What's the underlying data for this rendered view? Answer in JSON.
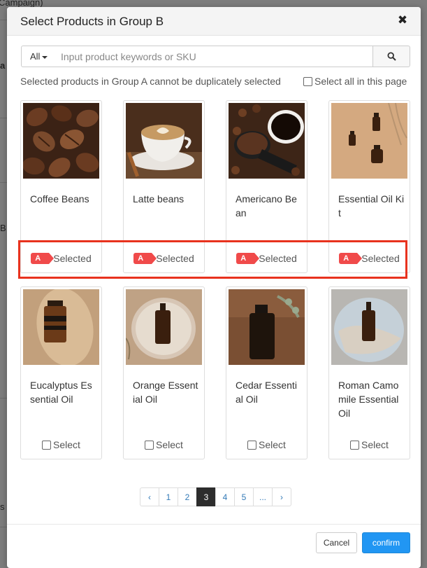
{
  "background": {
    "text_top": "Campaign)",
    "text_b": "B",
    "text_a": "a",
    "text_s": "s"
  },
  "modal": {
    "title": "Select Products in Group B",
    "close_glyph": "✖"
  },
  "search": {
    "scope": "All",
    "placeholder": "Input product keywords or SKU",
    "button_icon": "search-icon"
  },
  "hint": "Selected products in Group A cannot be duplicately selected",
  "select_all_label": "Select all in this page",
  "group_tag": "A",
  "products": [
    {
      "name": "Coffee Beans",
      "status": "Selected",
      "image": "coffee-beans"
    },
    {
      "name": "Latte beans",
      "status": "Selected",
      "image": "latte"
    },
    {
      "name": "Americano Bean",
      "status": "Selected",
      "image": "americano"
    },
    {
      "name": "Essential Oil Kit",
      "status": "Selected",
      "image": "essential-oil-kit"
    },
    {
      "name": "Eucalyptus Essential Oil",
      "status": "Select",
      "image": "eucalyptus"
    },
    {
      "name": "Orange Essential Oil",
      "status": "Select",
      "image": "orange-oil"
    },
    {
      "name": "Cedar Essential Oil",
      "status": "Select",
      "image": "cedar-oil"
    },
    {
      "name": "Roman Camomile Essential Oil",
      "status": "Select",
      "image": "camomile-oil"
    }
  ],
  "pagination": {
    "prev": "‹",
    "pages": [
      "1",
      "2",
      "3",
      "4",
      "5",
      "..."
    ],
    "current": "3",
    "next": "›"
  },
  "footer": {
    "cancel": "Cancel",
    "confirm": "confirm"
  },
  "colors": {
    "tag": "#f04a4a",
    "highlight": "#e8321e",
    "confirm": "#2196f3",
    "active_page": "#2d2d2d"
  }
}
